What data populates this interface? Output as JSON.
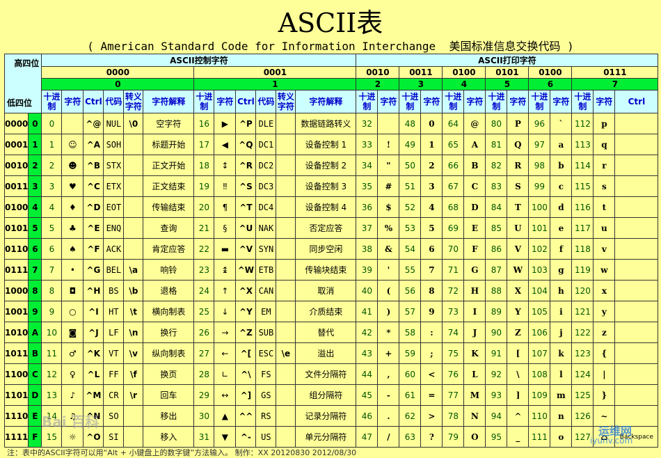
{
  "title": "ASCII表",
  "subtitle": "( American Standard Code for Information Interchange  美国标准信息交换代码 )",
  "header": {
    "high_label": "高四位",
    "low_label": "低四位",
    "control_section": "ASCII控制字符",
    "print_section": "ASCII打印字符",
    "control_groups": [
      {
        "bin": "0000",
        "hex": "0"
      },
      {
        "bin": "0001",
        "hex": "1"
      }
    ],
    "print_groups": [
      {
        "bin": "0010",
        "hex": "2"
      },
      {
        "bin": "0011",
        "hex": "3"
      },
      {
        "bin": "0100",
        "hex": "4"
      },
      {
        "bin": "0101",
        "hex": "5"
      },
      {
        "bin": "0100",
        "hex": "6"
      },
      {
        "bin": "0111",
        "hex": "7"
      }
    ],
    "col_dec": "十进制",
    "col_char": "字符",
    "col_ctrl": "Ctrl",
    "col_code": "代码",
    "col_esc": "转义字符",
    "col_desc": "字符解释"
  },
  "rows": [
    {
      "bin": "0000",
      "hex": "0",
      "c0": {
        "dec": "0",
        "char": "",
        "ctrl": "^@",
        "code": "NUL",
        "esc": "\\0",
        "desc": "空字符"
      },
      "c1": {
        "dec": "16",
        "char": "▶",
        "ctrl": "^P",
        "code": "DLE",
        "esc": "",
        "desc": "数据链路转义"
      },
      "p": [
        {
          "dec": "32",
          "char": ""
        },
        {
          "dec": "48",
          "char": "0"
        },
        {
          "dec": "64",
          "char": "@"
        },
        {
          "dec": "80",
          "char": "P"
        },
        {
          "dec": "96",
          "char": "`"
        },
        {
          "dec": "112",
          "char": "p"
        }
      ]
    },
    {
      "bin": "0001",
      "hex": "1",
      "c0": {
        "dec": "1",
        "char": "☺",
        "ctrl": "^A",
        "code": "SOH",
        "esc": "",
        "desc": "标题开始"
      },
      "c1": {
        "dec": "17",
        "char": "◀",
        "ctrl": "^Q",
        "code": "DC1",
        "esc": "",
        "desc": "设备控制 1"
      },
      "p": [
        {
          "dec": "33",
          "char": "!"
        },
        {
          "dec": "49",
          "char": "1"
        },
        {
          "dec": "65",
          "char": "A"
        },
        {
          "dec": "81",
          "char": "Q"
        },
        {
          "dec": "97",
          "char": "a"
        },
        {
          "dec": "113",
          "char": "q"
        }
      ]
    },
    {
      "bin": "0010",
      "hex": "2",
      "c0": {
        "dec": "2",
        "char": "☻",
        "ctrl": "^B",
        "code": "STX",
        "esc": "",
        "desc": "正文开始"
      },
      "c1": {
        "dec": "18",
        "char": "↕",
        "ctrl": "^R",
        "code": "DC2",
        "esc": "",
        "desc": "设备控制 2"
      },
      "p": [
        {
          "dec": "34",
          "char": "\""
        },
        {
          "dec": "50",
          "char": "2"
        },
        {
          "dec": "66",
          "char": "B"
        },
        {
          "dec": "82",
          "char": "R"
        },
        {
          "dec": "98",
          "char": "b"
        },
        {
          "dec": "114",
          "char": "r"
        }
      ]
    },
    {
      "bin": "0011",
      "hex": "3",
      "c0": {
        "dec": "3",
        "char": "♥",
        "ctrl": "^C",
        "code": "ETX",
        "esc": "",
        "desc": "正文结束"
      },
      "c1": {
        "dec": "19",
        "char": "‼",
        "ctrl": "^S",
        "code": "DC3",
        "esc": "",
        "desc": "设备控制 3"
      },
      "p": [
        {
          "dec": "35",
          "char": "#"
        },
        {
          "dec": "51",
          "char": "3"
        },
        {
          "dec": "67",
          "char": "C"
        },
        {
          "dec": "83",
          "char": "S"
        },
        {
          "dec": "99",
          "char": "c"
        },
        {
          "dec": "115",
          "char": "s"
        }
      ]
    },
    {
      "bin": "0100",
      "hex": "4",
      "c0": {
        "dec": "4",
        "char": "♦",
        "ctrl": "^D",
        "code": "EOT",
        "esc": "",
        "desc": "传输结束"
      },
      "c1": {
        "dec": "20",
        "char": "¶",
        "ctrl": "^T",
        "code": "DC4",
        "esc": "",
        "desc": "设备控制 4"
      },
      "p": [
        {
          "dec": "36",
          "char": "$"
        },
        {
          "dec": "52",
          "char": "4"
        },
        {
          "dec": "68",
          "char": "D"
        },
        {
          "dec": "84",
          "char": "T"
        },
        {
          "dec": "100",
          "char": "d"
        },
        {
          "dec": "116",
          "char": "t"
        }
      ]
    },
    {
      "bin": "0101",
      "hex": "5",
      "c0": {
        "dec": "5",
        "char": "♣",
        "ctrl": "^E",
        "code": "ENQ",
        "esc": "",
        "desc": "查询"
      },
      "c1": {
        "dec": "21",
        "char": "§",
        "ctrl": "^U",
        "code": "NAK",
        "esc": "",
        "desc": "否定应答"
      },
      "p": [
        {
          "dec": "37",
          "char": "%"
        },
        {
          "dec": "53",
          "char": "5"
        },
        {
          "dec": "69",
          "char": "E"
        },
        {
          "dec": "85",
          "char": "U"
        },
        {
          "dec": "101",
          "char": "e"
        },
        {
          "dec": "117",
          "char": "u"
        }
      ]
    },
    {
      "bin": "0110",
      "hex": "6",
      "c0": {
        "dec": "6",
        "char": "♠",
        "ctrl": "^F",
        "code": "ACK",
        "esc": "",
        "desc": "肯定应答"
      },
      "c1": {
        "dec": "22",
        "char": "▬",
        "ctrl": "^V",
        "code": "SYN",
        "esc": "",
        "desc": "同步空闲"
      },
      "p": [
        {
          "dec": "38",
          "char": "&"
        },
        {
          "dec": "54",
          "char": "6"
        },
        {
          "dec": "70",
          "char": "F"
        },
        {
          "dec": "86",
          "char": "V"
        },
        {
          "dec": "102",
          "char": "f"
        },
        {
          "dec": "118",
          "char": "v"
        }
      ]
    },
    {
      "bin": "0111",
      "hex": "7",
      "c0": {
        "dec": "7",
        "char": "•",
        "ctrl": "^G",
        "code": "BEL",
        "esc": "\\a",
        "desc": "响铃"
      },
      "c1": {
        "dec": "23",
        "char": "↨",
        "ctrl": "^W",
        "code": "ETB",
        "esc": "",
        "desc": "传输块结束"
      },
      "p": [
        {
          "dec": "39",
          "char": "'"
        },
        {
          "dec": "55",
          "char": "7"
        },
        {
          "dec": "71",
          "char": "G"
        },
        {
          "dec": "87",
          "char": "W"
        },
        {
          "dec": "103",
          "char": "g"
        },
        {
          "dec": "119",
          "char": "w"
        }
      ]
    },
    {
      "bin": "1000",
      "hex": "8",
      "c0": {
        "dec": "8",
        "char": "◘",
        "ctrl": "^H",
        "code": "BS",
        "esc": "\\b",
        "desc": "退格"
      },
      "c1": {
        "dec": "24",
        "char": "↑",
        "ctrl": "^X",
        "code": "CAN",
        "esc": "",
        "desc": "取消"
      },
      "p": [
        {
          "dec": "40",
          "char": "("
        },
        {
          "dec": "56",
          "char": "8"
        },
        {
          "dec": "72",
          "char": "H"
        },
        {
          "dec": "88",
          "char": "X"
        },
        {
          "dec": "104",
          "char": "h"
        },
        {
          "dec": "120",
          "char": "x"
        }
      ]
    },
    {
      "bin": "1001",
      "hex": "9",
      "c0": {
        "dec": "9",
        "char": "○",
        "ctrl": "^I",
        "code": "HT",
        "esc": "\\t",
        "desc": "横向制表"
      },
      "c1": {
        "dec": "25",
        "char": "↓",
        "ctrl": "^Y",
        "code": "EM",
        "esc": "",
        "desc": "介质结束"
      },
      "p": [
        {
          "dec": "41",
          "char": ")"
        },
        {
          "dec": "57",
          "char": "9"
        },
        {
          "dec": "73",
          "char": "I"
        },
        {
          "dec": "89",
          "char": "Y"
        },
        {
          "dec": "105",
          "char": "i"
        },
        {
          "dec": "121",
          "char": "y"
        }
      ]
    },
    {
      "bin": "1010",
      "hex": "A",
      "c0": {
        "dec": "10",
        "char": "◙",
        "ctrl": "^J",
        "code": "LF",
        "esc": "\\n",
        "desc": "换行"
      },
      "c1": {
        "dec": "26",
        "char": "→",
        "ctrl": "^Z",
        "code": "SUB",
        "esc": "",
        "desc": "替代"
      },
      "p": [
        {
          "dec": "42",
          "char": "*"
        },
        {
          "dec": "58",
          "char": ":"
        },
        {
          "dec": "74",
          "char": "J"
        },
        {
          "dec": "90",
          "char": "Z"
        },
        {
          "dec": "106",
          "char": "j"
        },
        {
          "dec": "122",
          "char": "z"
        }
      ]
    },
    {
      "bin": "1011",
      "hex": "B",
      "c0": {
        "dec": "11",
        "char": "♂",
        "ctrl": "^K",
        "code": "VT",
        "esc": "\\v",
        "desc": "纵向制表"
      },
      "c1": {
        "dec": "27",
        "char": "←",
        "ctrl": "^[",
        "code": "ESC",
        "esc": "\\e",
        "desc": "溢出"
      },
      "p": [
        {
          "dec": "43",
          "char": "+"
        },
        {
          "dec": "59",
          "char": ";"
        },
        {
          "dec": "75",
          "char": "K"
        },
        {
          "dec": "91",
          "char": "["
        },
        {
          "dec": "107",
          "char": "k"
        },
        {
          "dec": "123",
          "char": "{"
        }
      ]
    },
    {
      "bin": "1100",
      "hex": "C",
      "c0": {
        "dec": "12",
        "char": "♀",
        "ctrl": "^L",
        "code": "FF",
        "esc": "\\f",
        "desc": "换页"
      },
      "c1": {
        "dec": "28",
        "char": "∟",
        "ctrl": "^\\",
        "code": "FS",
        "esc": "",
        "desc": "文件分隔符"
      },
      "p": [
        {
          "dec": "44",
          "char": ","
        },
        {
          "dec": "60",
          "char": "<"
        },
        {
          "dec": "76",
          "char": "L"
        },
        {
          "dec": "92",
          "char": "\\"
        },
        {
          "dec": "108",
          "char": "l"
        },
        {
          "dec": "124",
          "char": "|"
        }
      ]
    },
    {
      "bin": "1101",
      "hex": "D",
      "c0": {
        "dec": "13",
        "char": "♪",
        "ctrl": "^M",
        "code": "CR",
        "esc": "\\r",
        "desc": "回车"
      },
      "c1": {
        "dec": "29",
        "char": "↔",
        "ctrl": "^]",
        "code": "GS",
        "esc": "",
        "desc": "组分隔符"
      },
      "p": [
        {
          "dec": "45",
          "char": "-"
        },
        {
          "dec": "61",
          "char": "="
        },
        {
          "dec": "77",
          "char": "M"
        },
        {
          "dec": "93",
          "char": "]"
        },
        {
          "dec": "109",
          "char": "m"
        },
        {
          "dec": "125",
          "char": "}"
        }
      ]
    },
    {
      "bin": "1110",
      "hex": "E",
      "c0": {
        "dec": "14",
        "char": "♫",
        "ctrl": "^N",
        "code": "SO",
        "esc": "",
        "desc": "移出"
      },
      "c1": {
        "dec": "30",
        "char": "▲",
        "ctrl": "^^",
        "code": "RS",
        "esc": "",
        "desc": "记录分隔符"
      },
      "p": [
        {
          "dec": "46",
          "char": "."
        },
        {
          "dec": "62",
          "char": ">"
        },
        {
          "dec": "78",
          "char": "N"
        },
        {
          "dec": "94",
          "char": "^"
        },
        {
          "dec": "110",
          "char": "n"
        },
        {
          "dec": "126",
          "char": "~"
        }
      ]
    },
    {
      "bin": "1111",
      "hex": "F",
      "c0": {
        "dec": "15",
        "char": "☼",
        "ctrl": "^O",
        "code": "SI",
        "esc": "",
        "desc": "移入"
      },
      "c1": {
        "dec": "31",
        "char": "▼",
        "ctrl": "^-",
        "code": "US",
        "esc": "",
        "desc": "单元分隔符"
      },
      "p": [
        {
          "dec": "47",
          "char": "/"
        },
        {
          "dec": "63",
          "char": "?"
        },
        {
          "dec": "79",
          "char": "O"
        },
        {
          "dec": "95",
          "char": "_"
        },
        {
          "dec": "111",
          "char": "o"
        },
        {
          "dec": "127",
          "char": "⌂"
        }
      ]
    }
  ],
  "last_row_extra": "Backspace",
  "footer": "注：表中的ASCII字符可以用“Alt + 小键盘上的数字键”方法输入。                    制作：XX        20120830    2012/08/30",
  "watermarks": {
    "left": "Bai 百科",
    "right_brand": "运维网",
    "right_url": "iyunv.com"
  }
}
